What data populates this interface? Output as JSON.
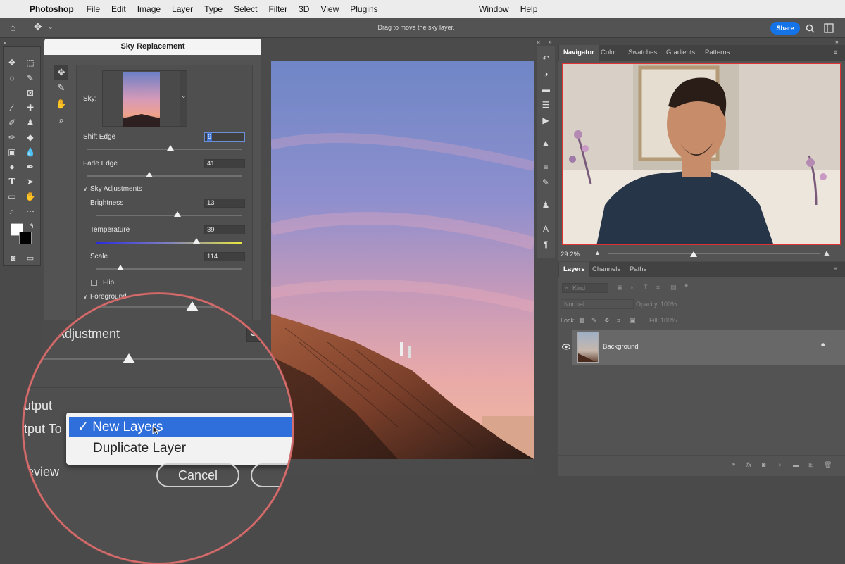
{
  "menubar": {
    "app": "Photoshop",
    "items": [
      "File",
      "Edit",
      "Image",
      "Layer",
      "Type",
      "Select",
      "Filter",
      "3D",
      "View",
      "Plugins"
    ],
    "right_items": [
      "Window",
      "Help"
    ]
  },
  "optionsbar": {
    "hint": "Drag to move the sky layer.",
    "share_label": "Share"
  },
  "dialog": {
    "title": "Sky Replacement",
    "sky_label": "Sky:",
    "shift_edge": {
      "label": "Shift Edge",
      "value": "9"
    },
    "fade_edge": {
      "label": "Fade Edge",
      "value": "41"
    },
    "sky_adjustments_label": "Sky Adjustments",
    "brightness": {
      "label": "Brightness",
      "value": "13"
    },
    "temperature": {
      "label": "Temperature",
      "value": "39"
    },
    "scale": {
      "label": "Scale",
      "value": "114"
    },
    "flip_label": "Flip",
    "foreground_label": "Foreground"
  },
  "magnifier": {
    "adjustment_label": "Adjustment",
    "output_label": "utput",
    "output_to_label": "tput To",
    "preview_label": "eview",
    "cancel_label": "Cancel",
    "selected_option": "✓ New Layers",
    "other_option": "Duplicate Layer"
  },
  "navigator": {
    "tabs": [
      "Navigator",
      "Color",
      "Swatches",
      "Gradients",
      "Patterns"
    ],
    "zoom": "29.2%"
  },
  "layers": {
    "tabs": [
      "Layers",
      "Channels",
      "Paths"
    ],
    "kind_placeholder": "Kind",
    "blend_mode": "Normal",
    "opacity_label": "Opacity:",
    "opacity_value": "100%",
    "lock_label": "Lock:",
    "fill_label": "Fill:",
    "fill_value": "100%",
    "layer_name": "Background"
  }
}
